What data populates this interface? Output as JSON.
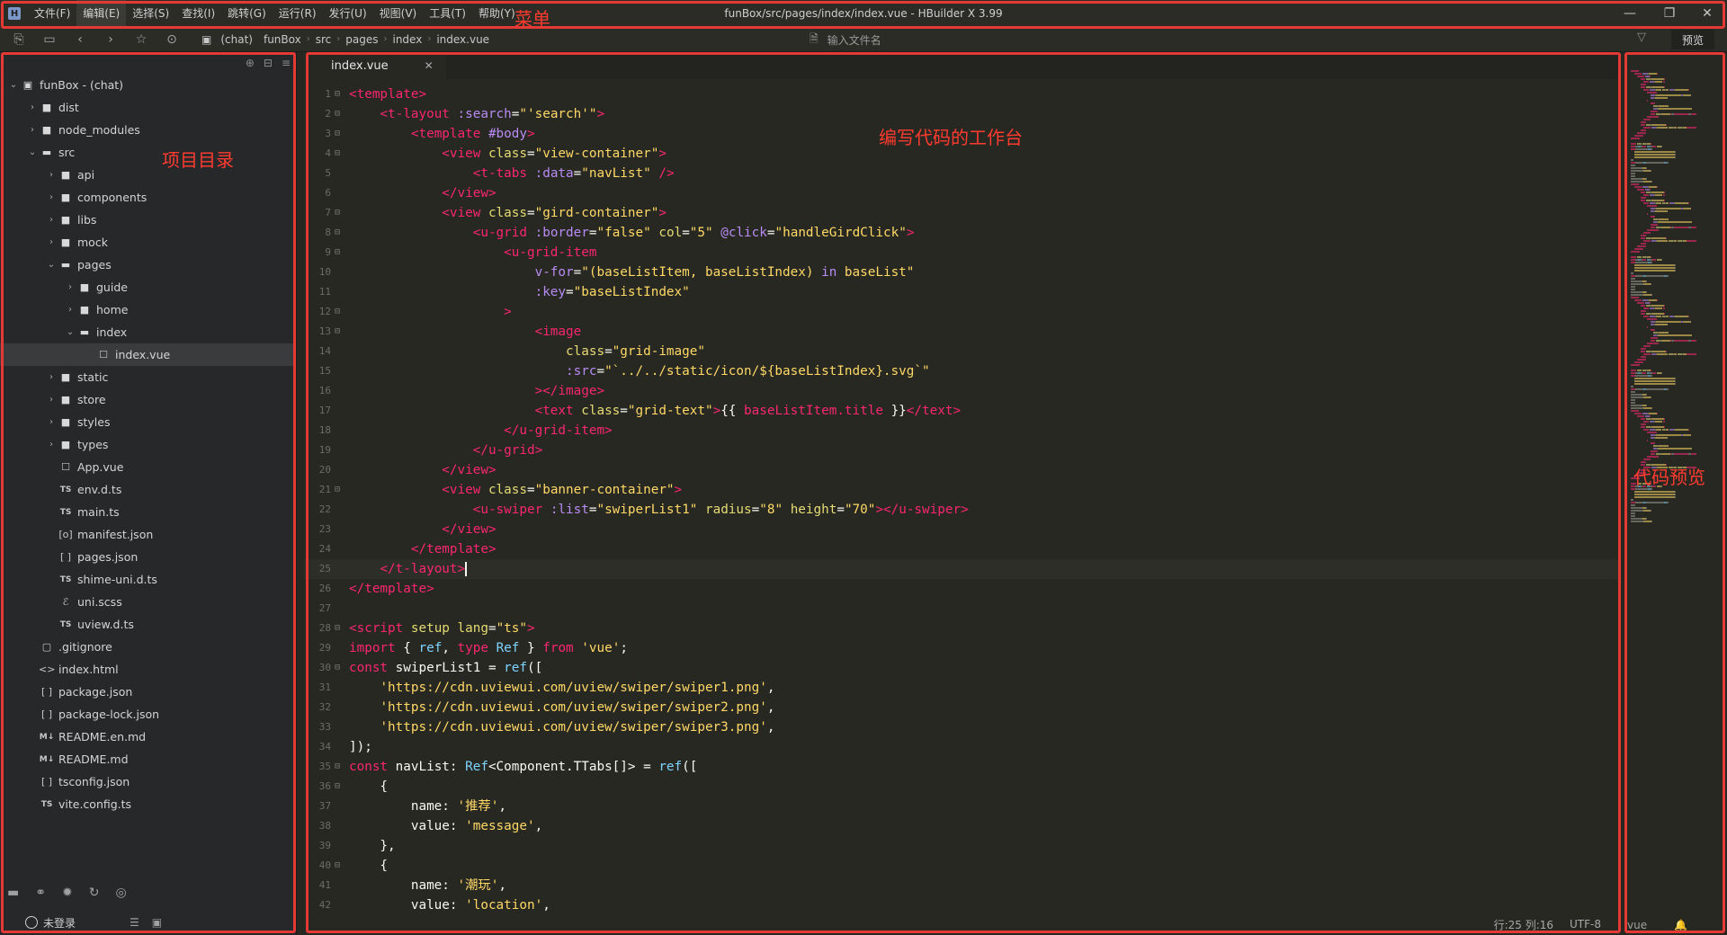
{
  "menu": {
    "app_logo": "H",
    "items": [
      "文件(F)",
      "编辑(E)",
      "选择(S)",
      "查找(I)",
      "跳转(G)",
      "运行(R)",
      "发行(U)",
      "视图(V)",
      "工具(T)",
      "帮助(Y)"
    ],
    "active_index": 1,
    "window_title": "funBox/src/pages/index/index.vue - HBuilder X 3.99"
  },
  "toolbar": {
    "breadcrumb": [
      "(chat)",
      "funBox",
      "src",
      "pages",
      "index",
      "index.vue"
    ],
    "file_search_placeholder": "输入文件名",
    "preview_label": "预览"
  },
  "sidebar": {
    "tree": [
      {
        "label": "funBox - (chat)",
        "depth": 0,
        "type": "project",
        "expanded": true
      },
      {
        "label": "dist",
        "depth": 1,
        "type": "folder",
        "expanded": false
      },
      {
        "label": "node_modules",
        "depth": 1,
        "type": "folder",
        "expanded": false
      },
      {
        "label": "src",
        "depth": 1,
        "type": "folder-open",
        "expanded": true
      },
      {
        "label": "api",
        "depth": 2,
        "type": "folder",
        "expanded": false
      },
      {
        "label": "components",
        "depth": 2,
        "type": "folder",
        "expanded": false
      },
      {
        "label": "libs",
        "depth": 2,
        "type": "folder",
        "expanded": false
      },
      {
        "label": "mock",
        "depth": 2,
        "type": "folder",
        "expanded": false
      },
      {
        "label": "pages",
        "depth": 2,
        "type": "folder-open",
        "expanded": true
      },
      {
        "label": "guide",
        "depth": 3,
        "type": "folder",
        "expanded": false
      },
      {
        "label": "home",
        "depth": 3,
        "type": "folder",
        "expanded": false
      },
      {
        "label": "index",
        "depth": 3,
        "type": "folder-open",
        "expanded": true
      },
      {
        "label": "index.vue",
        "depth": 4,
        "type": "vue",
        "selected": true
      },
      {
        "label": "static",
        "depth": 2,
        "type": "folder",
        "expanded": false
      },
      {
        "label": "store",
        "depth": 2,
        "type": "folder",
        "expanded": false
      },
      {
        "label": "styles",
        "depth": 2,
        "type": "folder",
        "expanded": false
      },
      {
        "label": "types",
        "depth": 2,
        "type": "folder",
        "expanded": false
      },
      {
        "label": "App.vue",
        "depth": 2,
        "type": "vue"
      },
      {
        "label": "env.d.ts",
        "depth": 2,
        "type": "ts"
      },
      {
        "label": "main.ts",
        "depth": 2,
        "type": "ts"
      },
      {
        "label": "manifest.json",
        "depth": 2,
        "type": "manifest"
      },
      {
        "label": "pages.json",
        "depth": 2,
        "type": "json"
      },
      {
        "label": "shime-uni.d.ts",
        "depth": 2,
        "type": "ts"
      },
      {
        "label": "uni.scss",
        "depth": 2,
        "type": "scss"
      },
      {
        "label": "uview.d.ts",
        "depth": 2,
        "type": "ts"
      },
      {
        "label": ".gitignore",
        "depth": 1,
        "type": "file"
      },
      {
        "label": "index.html",
        "depth": 1,
        "type": "html"
      },
      {
        "label": "package.json",
        "depth": 1,
        "type": "json"
      },
      {
        "label": "package-lock.json",
        "depth": 1,
        "type": "json"
      },
      {
        "label": "README.en.md",
        "depth": 1,
        "type": "md"
      },
      {
        "label": "README.md",
        "depth": 1,
        "type": "md"
      },
      {
        "label": "tsconfig.json",
        "depth": 1,
        "type": "json"
      },
      {
        "label": "vite.config.ts",
        "depth": 1,
        "type": "ts"
      }
    ],
    "login_label": "未登录"
  },
  "editor": {
    "tab_label": "index.vue",
    "current_line": 25,
    "lines": [
      [
        [
          "tk-tag-b",
          "<template>"
        ]
      ],
      [
        [
          "tk-plain",
          "    "
        ],
        [
          "tk-tag-b",
          "<t-layout"
        ],
        [
          "tk-plain",
          " "
        ],
        [
          "tk-dir",
          ":search"
        ],
        [
          "tk-plain",
          "="
        ],
        [
          "tk-str",
          "\"'search'\""
        ],
        [
          "tk-tag-b",
          ">"
        ]
      ],
      [
        [
          "tk-plain",
          "        "
        ],
        [
          "tk-tag-b",
          "<template"
        ],
        [
          "tk-plain",
          " "
        ],
        [
          "tk-dir",
          "#body"
        ],
        [
          "tk-tag-b",
          ">"
        ]
      ],
      [
        [
          "tk-plain",
          "            "
        ],
        [
          "tk-tag-b",
          "<view"
        ],
        [
          "tk-plain",
          " "
        ],
        [
          "tk-attr",
          "class"
        ],
        [
          "tk-plain",
          "="
        ],
        [
          "tk-str",
          "\"view-container\""
        ],
        [
          "tk-tag-b",
          ">"
        ]
      ],
      [
        [
          "tk-plain",
          "                "
        ],
        [
          "tk-tag-b",
          "<t-tabs"
        ],
        [
          "tk-plain",
          " "
        ],
        [
          "tk-dir",
          ":data"
        ],
        [
          "tk-plain",
          "="
        ],
        [
          "tk-str",
          "\"navList\""
        ],
        [
          "tk-plain",
          " "
        ],
        [
          "tk-tag-b",
          "/>"
        ]
      ],
      [
        [
          "tk-plain",
          "            "
        ],
        [
          "tk-tag-b",
          "</view>"
        ]
      ],
      [
        [
          "tk-plain",
          "            "
        ],
        [
          "tk-tag-b",
          "<view"
        ],
        [
          "tk-plain",
          " "
        ],
        [
          "tk-attr",
          "class"
        ],
        [
          "tk-plain",
          "="
        ],
        [
          "tk-str",
          "\"gird-container\""
        ],
        [
          "tk-tag-b",
          ">"
        ]
      ],
      [
        [
          "tk-plain",
          "                "
        ],
        [
          "tk-tag-b",
          "<u-grid"
        ],
        [
          "tk-plain",
          " "
        ],
        [
          "tk-dir",
          ":border"
        ],
        [
          "tk-plain",
          "="
        ],
        [
          "tk-str",
          "\"false\""
        ],
        [
          "tk-plain",
          " "
        ],
        [
          "tk-attr",
          "col"
        ],
        [
          "tk-plain",
          "="
        ],
        [
          "tk-str",
          "\"5\""
        ],
        [
          "tk-plain",
          " "
        ],
        [
          "tk-dir",
          "@click"
        ],
        [
          "tk-plain",
          "="
        ],
        [
          "tk-str",
          "\"handleGirdClick\""
        ],
        [
          "tk-tag-b",
          ">"
        ]
      ],
      [
        [
          "tk-plain",
          "                    "
        ],
        [
          "tk-tag-b",
          "<u-grid-item"
        ]
      ],
      [
        [
          "tk-plain",
          "                        "
        ],
        [
          "tk-dir",
          "v-for"
        ],
        [
          "tk-plain",
          "="
        ],
        [
          "tk-str",
          "\"(baseListItem, baseListIndex) "
        ],
        [
          "tk-dir",
          "in"
        ],
        [
          "tk-str",
          " baseList\""
        ]
      ],
      [
        [
          "tk-plain",
          "                        "
        ],
        [
          "tk-dir",
          ":key"
        ],
        [
          "tk-plain",
          "="
        ],
        [
          "tk-str",
          "\"baseListIndex\""
        ]
      ],
      [
        [
          "tk-plain",
          "                    "
        ],
        [
          "tk-tag-b",
          ">"
        ]
      ],
      [
        [
          "tk-plain",
          "                        "
        ],
        [
          "tk-tag-b",
          "<image"
        ]
      ],
      [
        [
          "tk-plain",
          "                            "
        ],
        [
          "tk-attr",
          "class"
        ],
        [
          "tk-plain",
          "="
        ],
        [
          "tk-str",
          "\"grid-image\""
        ]
      ],
      [
        [
          "tk-plain",
          "                            "
        ],
        [
          "tk-dir",
          ":src"
        ],
        [
          "tk-plain",
          "="
        ],
        [
          "tk-str",
          "\"`../../static/icon/${baseListIndex}.svg`\""
        ]
      ],
      [
        [
          "tk-plain",
          "                        "
        ],
        [
          "tk-tag-b",
          "></image>"
        ]
      ],
      [
        [
          "tk-plain",
          "                        "
        ],
        [
          "tk-tag-b",
          "<text"
        ],
        [
          "tk-plain",
          " "
        ],
        [
          "tk-attr",
          "class"
        ],
        [
          "tk-plain",
          "="
        ],
        [
          "tk-str",
          "\"grid-text\""
        ],
        [
          "tk-tag-b",
          ">"
        ],
        [
          "tk-plain",
          "{{ "
        ],
        [
          "tk-tag-b",
          "baseListItem.title"
        ],
        [
          "tk-plain",
          " }}"
        ],
        [
          "tk-tag-b",
          "</text>"
        ]
      ],
      [
        [
          "tk-plain",
          "                    "
        ],
        [
          "tk-tag-b",
          "</u-grid-item>"
        ]
      ],
      [
        [
          "tk-plain",
          "                "
        ],
        [
          "tk-tag-b",
          "</u-grid>"
        ]
      ],
      [
        [
          "tk-plain",
          "            "
        ],
        [
          "tk-tag-b",
          "</view>"
        ]
      ],
      [
        [
          "tk-plain",
          "            "
        ],
        [
          "tk-tag-b",
          "<view"
        ],
        [
          "tk-plain",
          " "
        ],
        [
          "tk-attr",
          "class"
        ],
        [
          "tk-plain",
          "="
        ],
        [
          "tk-str",
          "\"banner-container\""
        ],
        [
          "tk-tag-b",
          ">"
        ]
      ],
      [
        [
          "tk-plain",
          "                "
        ],
        [
          "tk-tag-b",
          "<u-swiper"
        ],
        [
          "tk-plain",
          " "
        ],
        [
          "tk-dir",
          ":list"
        ],
        [
          "tk-plain",
          "="
        ],
        [
          "tk-str",
          "\"swiperList1\""
        ],
        [
          "tk-plain",
          " "
        ],
        [
          "tk-attr",
          "radius"
        ],
        [
          "tk-plain",
          "="
        ],
        [
          "tk-str",
          "\"8\""
        ],
        [
          "tk-plain",
          " "
        ],
        [
          "tk-attr",
          "height"
        ],
        [
          "tk-plain",
          "="
        ],
        [
          "tk-str",
          "\"70\""
        ],
        [
          "tk-tag-b",
          "></u-swiper>"
        ]
      ],
      [
        [
          "tk-plain",
          "            "
        ],
        [
          "tk-tag-b",
          "</view>"
        ]
      ],
      [
        [
          "tk-plain",
          "        "
        ],
        [
          "tk-tag-b",
          "</template>"
        ]
      ],
      [
        [
          "tk-plain",
          "    "
        ],
        [
          "tk-tag-b",
          "</t-layout>"
        ],
        [
          "cursor",
          ""
        ]
      ],
      [
        [
          "tk-tag-b",
          "</template>"
        ]
      ],
      [
        [
          "tk-plain",
          ""
        ]
      ],
      [
        [
          "tk-tag-b",
          "<script"
        ],
        [
          "tk-plain",
          " "
        ],
        [
          "tk-attr",
          "setup"
        ],
        [
          "tk-plain",
          " "
        ],
        [
          "tk-attr",
          "lang"
        ],
        [
          "tk-plain",
          "="
        ],
        [
          "tk-str",
          "\"ts\""
        ],
        [
          "tk-tag-b",
          ">"
        ]
      ],
      [
        [
          "tk-kw",
          "import"
        ],
        [
          "tk-plain",
          " { "
        ],
        [
          "tk-def",
          "ref"
        ],
        [
          "tk-plain",
          ", "
        ],
        [
          "tk-kw",
          "type"
        ],
        [
          "tk-plain",
          " "
        ],
        [
          "tk-def",
          "Ref"
        ],
        [
          "tk-plain",
          " } "
        ],
        [
          "tk-kw",
          "from"
        ],
        [
          "tk-plain",
          " "
        ],
        [
          "tk-str",
          "'vue'"
        ],
        [
          "tk-plain",
          ";"
        ]
      ],
      [
        [
          "tk-kw",
          "const"
        ],
        [
          "tk-plain",
          " swiperList1 = "
        ],
        [
          "tk-def",
          "ref"
        ],
        [
          "tk-plain",
          "(["
        ]
      ],
      [
        [
          "tk-plain",
          "    "
        ],
        [
          "tk-str",
          "'https://cdn.uviewui.com/uview/swiper/swiper1.png'"
        ],
        [
          "tk-plain",
          ","
        ]
      ],
      [
        [
          "tk-plain",
          "    "
        ],
        [
          "tk-str",
          "'https://cdn.uviewui.com/uview/swiper/swiper2.png'"
        ],
        [
          "tk-plain",
          ","
        ]
      ],
      [
        [
          "tk-plain",
          "    "
        ],
        [
          "tk-str",
          "'https://cdn.uviewui.com/uview/swiper/swiper3.png'"
        ],
        [
          "tk-plain",
          ","
        ]
      ],
      [
        [
          "tk-plain",
          "]);"
        ]
      ],
      [
        [
          "tk-kw",
          "const"
        ],
        [
          "tk-plain",
          " navList: "
        ],
        [
          "tk-def",
          "Ref"
        ],
        [
          "tk-plain",
          "<Component.TTabs[]> = "
        ],
        [
          "tk-def",
          "ref"
        ],
        [
          "tk-plain",
          "(["
        ]
      ],
      [
        [
          "tk-plain",
          "    {"
        ]
      ],
      [
        [
          "tk-plain",
          "        name: "
        ],
        [
          "tk-str",
          "'推荐'"
        ],
        [
          "tk-plain",
          ","
        ]
      ],
      [
        [
          "tk-plain",
          "        value: "
        ],
        [
          "tk-str",
          "'message'"
        ],
        [
          "tk-plain",
          ","
        ]
      ],
      [
        [
          "tk-plain",
          "    },"
        ]
      ],
      [
        [
          "tk-plain",
          "    {"
        ]
      ],
      [
        [
          "tk-plain",
          "        name: "
        ],
        [
          "tk-str",
          "'潮玩'"
        ],
        [
          "tk-plain",
          ","
        ]
      ],
      [
        [
          "tk-plain",
          "        value: "
        ],
        [
          "tk-str",
          "'location'"
        ],
        [
          "tk-plain",
          ","
        ]
      ]
    ],
    "fold_lines": [
      1,
      2,
      3,
      4,
      7,
      8,
      9,
      12,
      13,
      21,
      28,
      30,
      35,
      36,
      40
    ],
    "status": {
      "position": "行:25  列:16",
      "encoding": "UTF-8",
      "language": "vue"
    }
  },
  "annotations": {
    "menu": "菜单",
    "project_dir": "项目目录",
    "workspace": "编写代码的工作台",
    "code_preview": "代码预览"
  },
  "colors": {
    "annotation_red": "#e53935",
    "editor_bg": "#272822",
    "sidebar_bg": "#27282a"
  }
}
